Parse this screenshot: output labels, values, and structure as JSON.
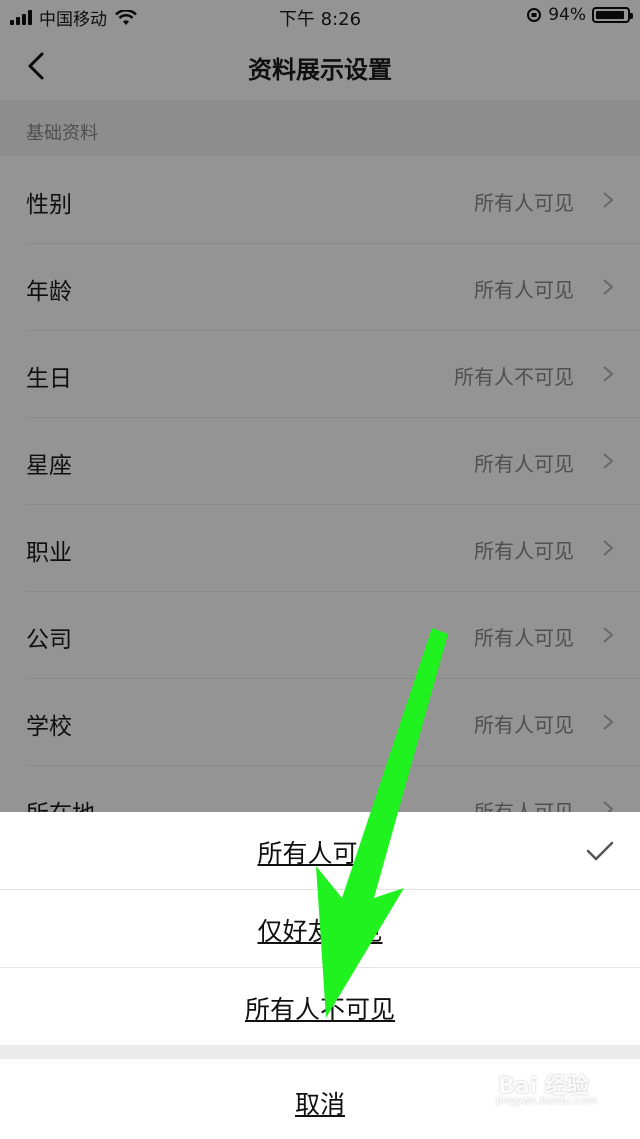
{
  "status_bar": {
    "carrier": "中国移动",
    "time": "下午 8:26",
    "battery": "94%",
    "battery_level": 0.94
  },
  "nav": {
    "title": "资料展示设置",
    "back_icon": "chevron-left-icon"
  },
  "section": {
    "label": "基础资料"
  },
  "rows": [
    {
      "label": "性别",
      "value": "所有人可见"
    },
    {
      "label": "年龄",
      "value": "所有人可见"
    },
    {
      "label": "生日",
      "value": "所有人不可见"
    },
    {
      "label": "星座",
      "value": "所有人可见"
    },
    {
      "label": "职业",
      "value": "所有人可见"
    },
    {
      "label": "公司",
      "value": "所有人可见"
    },
    {
      "label": "学校",
      "value": "所有人可见"
    },
    {
      "label": "所在地",
      "value": "所有人可见"
    }
  ],
  "sheet": {
    "options": [
      {
        "label": "所有人可见",
        "selected": true
      },
      {
        "label": "仅好友可见",
        "selected": false
      },
      {
        "label": "所有人不可见",
        "selected": false
      }
    ],
    "cancel": "取消"
  },
  "annotation": {
    "arrow_color": "#1ff21f"
  },
  "watermark": {
    "brand": "Bai 经验",
    "url": "jingyan.baidu.com"
  }
}
